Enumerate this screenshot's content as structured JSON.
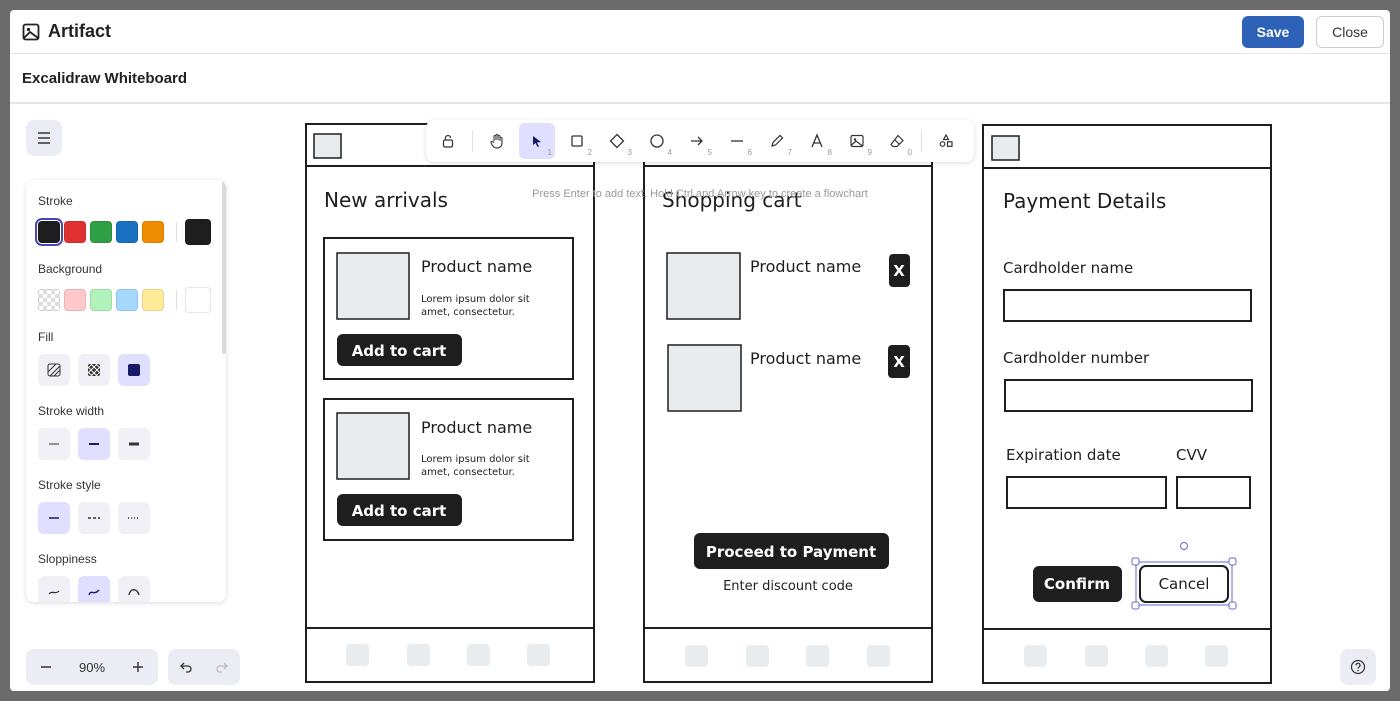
{
  "header": {
    "title": "Artifact",
    "save_label": "Save",
    "close_label": "Close"
  },
  "subheader": {
    "title": "Excalidraw Whiteboard"
  },
  "panel": {
    "stroke_label": "Stroke",
    "background_label": "Background",
    "fill_label": "Fill",
    "stroke_width_label": "Stroke width",
    "stroke_style_label": "Stroke style",
    "sloppiness_label": "Sloppiness",
    "stroke_colors": [
      "#1e1e1e",
      "#e03131",
      "#2f9e44",
      "#1971c2",
      "#f08c00"
    ],
    "stroke_current": "#1e1e1e",
    "background_colors": [
      "transparent",
      "#ffc9c9",
      "#b2f2bb",
      "#a5d8ff",
      "#ffec99"
    ],
    "background_current": "#ffffff"
  },
  "toolbar": {
    "shortcuts": [
      "1",
      "2",
      "3",
      "4",
      "5",
      "6",
      "7",
      "8",
      "9",
      "0"
    ],
    "hint": "Press Enter to add text. Hold Ctrl and Arrow key to create a flowchart"
  },
  "zoom": {
    "value": "90%"
  },
  "screen1": {
    "title": "New arrivals",
    "cards": [
      {
        "name": "Product name",
        "desc1": "Lorem ipsum dolor sit",
        "desc2": "amet, consectetur.",
        "button": "Add to cart"
      },
      {
        "name": "Product name",
        "desc1": "Lorem ipsum dolor sit",
        "desc2": "amet, consectetur.",
        "button": "Add to cart"
      }
    ]
  },
  "screen2": {
    "title": "Shopping cart",
    "items": [
      {
        "name": "Product name",
        "remove": "X"
      },
      {
        "name": "Product name",
        "remove": "X"
      }
    ],
    "proceed": "Proceed to Payment",
    "discount": "Enter discount code"
  },
  "screen3": {
    "title": "Payment Details",
    "cardholder_name": "Cardholder name",
    "cardholder_number": "Cardholder number",
    "expiration": "Expiration date",
    "cvv": "CVV",
    "confirm": "Confirm",
    "cancel": "Cancel"
  }
}
